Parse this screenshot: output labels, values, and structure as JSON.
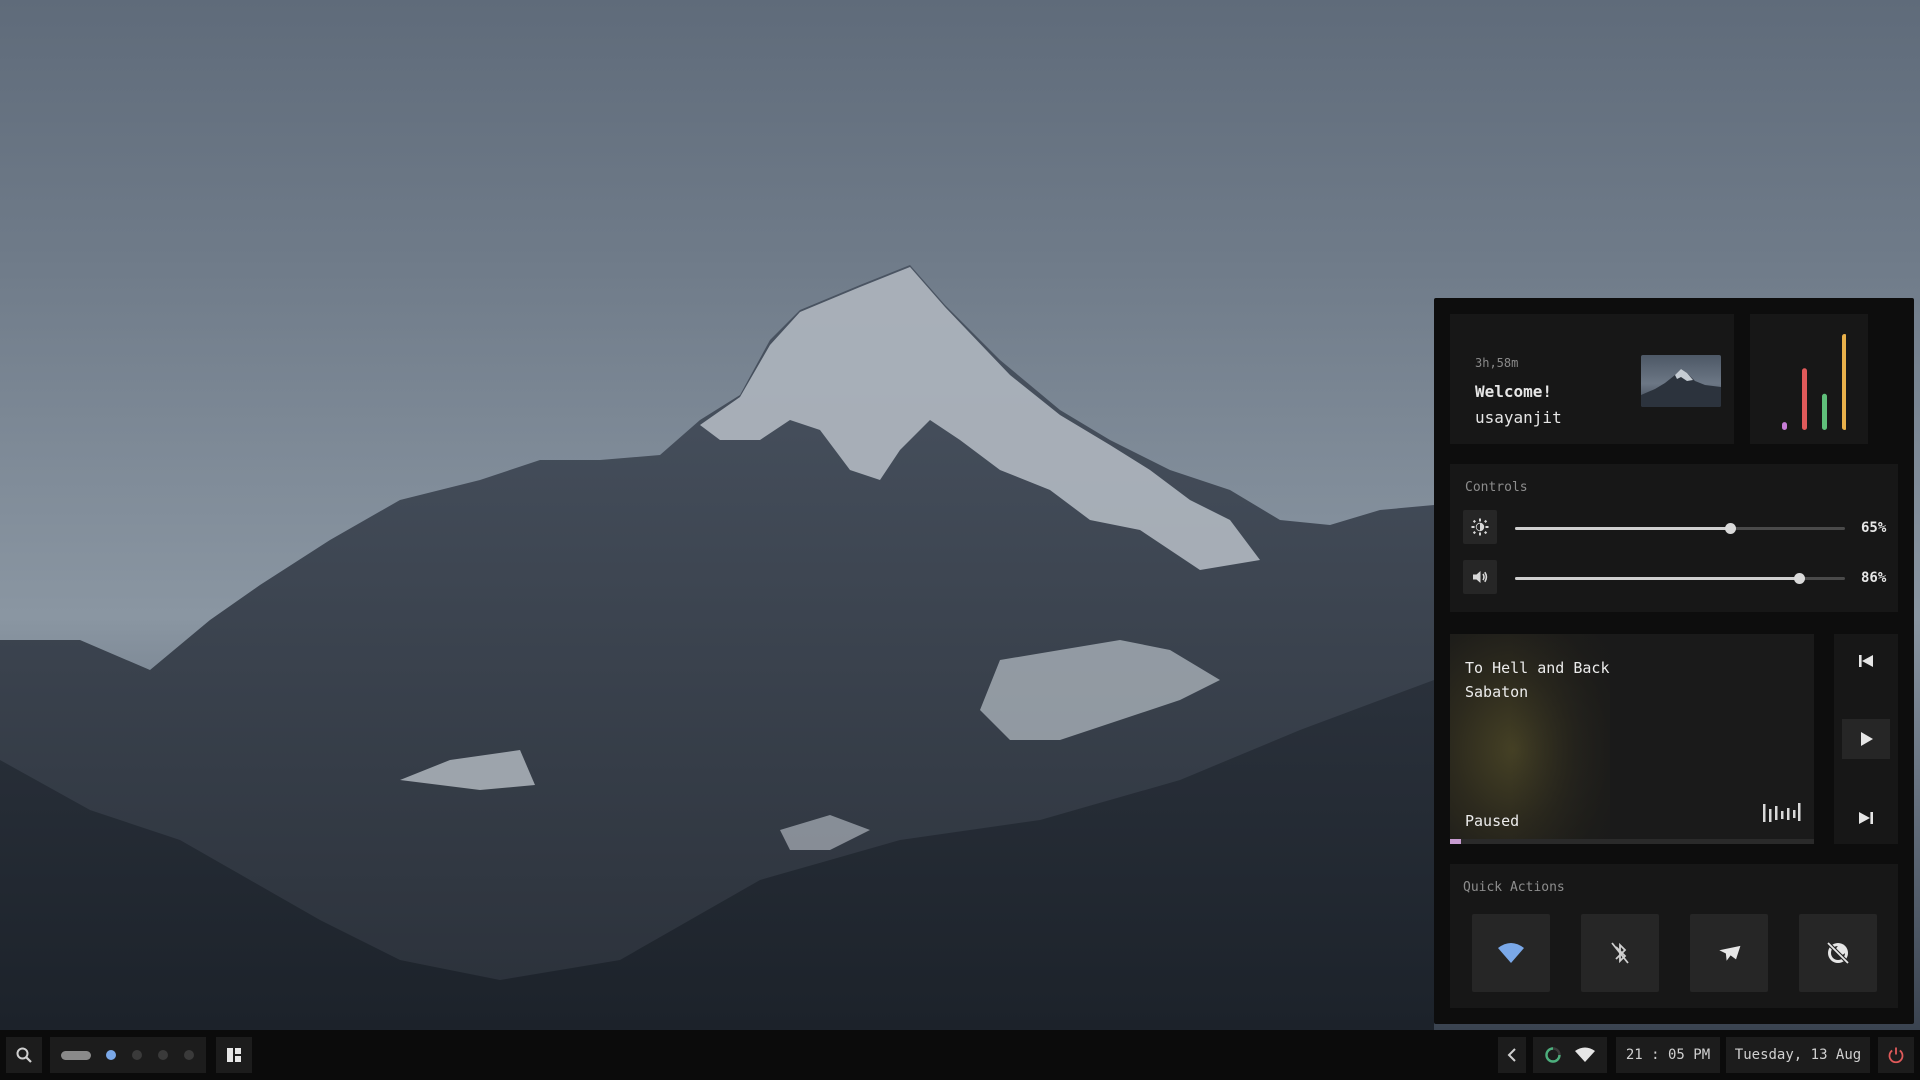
{
  "dashboard": {
    "welcome": {
      "uptime": "3h,58m",
      "title": "Welcome!",
      "username": "usayanjit"
    },
    "stats": {
      "bars": [
        {
          "level": 0.08,
          "color": "#c77dd6"
        },
        {
          "level": 0.63,
          "color": "#e05a5a"
        },
        {
          "level": 0.37,
          "color": "#5fbf7a"
        },
        {
          "level": 0.98,
          "color": "#e8b04a"
        }
      ]
    },
    "controls": {
      "label": "Controls",
      "brightness": {
        "value": 0.65,
        "label": "65%"
      },
      "volume": {
        "value": 0.86,
        "label": "86%"
      }
    },
    "music": {
      "title": "To Hell and Back",
      "artist": "Sabaton",
      "status": "Paused",
      "progress": 0.03,
      "progress_color": "#c79bd0"
    },
    "quick_actions": {
      "label": "Quick Actions",
      "buttons": [
        {
          "name": "wifi",
          "active": true,
          "color": "#7aa8e8"
        },
        {
          "name": "bluetooth",
          "active": false
        },
        {
          "name": "airplane-mode",
          "active": false
        },
        {
          "name": "do-not-disturb",
          "active": false
        }
      ]
    }
  },
  "taskbar": {
    "workspaces": {
      "active": 1,
      "count": 5,
      "active_color": "#7aa8e8"
    },
    "clock": "21 : 05 PM",
    "date": "Tuesday, 13 Aug",
    "power_color": "#e05a5a"
  }
}
